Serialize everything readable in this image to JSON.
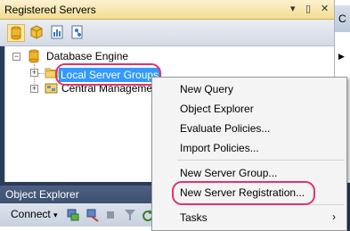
{
  "registered_servers": {
    "title": "Registered Servers",
    "window_controls": [
      "▾",
      "▯",
      "✕"
    ]
  },
  "tree": {
    "root_label": "Database Engine",
    "root_expander": "−",
    "children": [
      {
        "label": "Local Server Groups",
        "expander": "+"
      },
      {
        "label": "Central Management Servers",
        "expander": "+"
      }
    ]
  },
  "right_pane_label": "C",
  "object_explorer": {
    "title": "Object Explorer",
    "connect_label": "Connect",
    "connect_arrow": "▾"
  },
  "context_menu": {
    "items": [
      {
        "label": "New Query"
      },
      {
        "label": "Object Explorer"
      },
      {
        "label": "Evaluate Policies..."
      },
      {
        "label": "Import Policies..."
      },
      {
        "label": "New Server Group..."
      },
      {
        "label": "New Server Registration..."
      },
      {
        "label": "Tasks",
        "submenu_arrow": "›"
      }
    ]
  },
  "colors": {
    "highlight": "#e2336b",
    "selection": "#3399ff"
  }
}
